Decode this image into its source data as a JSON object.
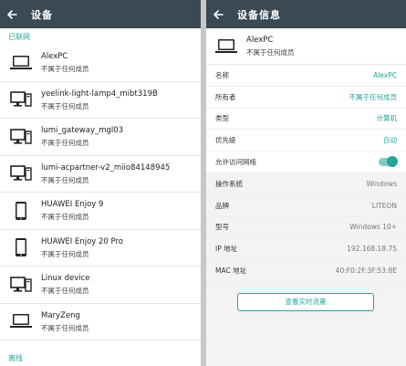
{
  "left": {
    "title": "设备",
    "online_label": "已联网",
    "offline_label": "离线",
    "devices": [
      {
        "name": "AlexPC",
        "owner": "不属于任何成员",
        "icon": "laptop-icon"
      },
      {
        "name": "yeelink-light-lamp4_mibt319B",
        "owner": "不属于任何成员",
        "icon": "desktop-icon"
      },
      {
        "name": "lumi_gateway_mgl03",
        "owner": "不属于任何成员",
        "icon": "desktop-icon"
      },
      {
        "name": "lumi-acpartner-v2_miio84148945",
        "owner": "不属于任何成员",
        "icon": "desktop-icon"
      },
      {
        "name": "HUAWEI Enjoy 9",
        "owner": "不属于任何成员",
        "icon": "phone-icon"
      },
      {
        "name": "HUAWEI Enjoy 20 Pro",
        "owner": "不属于任何成员",
        "icon": "phone-icon"
      },
      {
        "name": "Linux device",
        "owner": "不属于任何成员",
        "icon": "desktop-icon"
      },
      {
        "name": "MaryZeng",
        "owner": "不属于任何成员",
        "icon": "laptop-icon"
      }
    ]
  },
  "right": {
    "title": "设备信息",
    "device": {
      "name": "AlexPC",
      "owner": "不属于任何成员",
      "icon": "laptop-icon"
    },
    "editable_rows": [
      {
        "label": "名称",
        "value": "AlexPC"
      },
      {
        "label": "所有者",
        "value": "不属于任何成员"
      },
      {
        "label": "类型",
        "value": "计算机"
      },
      {
        "label": "优先级",
        "value": "自动"
      }
    ],
    "network_access": {
      "label": "允许访问网络",
      "enabled": true
    },
    "info_rows": [
      {
        "label": "操作系统",
        "value": "Windows"
      },
      {
        "label": "品牌",
        "value": "LITEON"
      },
      {
        "label": "型号",
        "value": "Windows 10+"
      },
      {
        "label": "IP 地址",
        "value": "192.168.18.75"
      },
      {
        "label": "MAC 地址",
        "value": "40:F0:2F:3F:53:8E"
      }
    ],
    "traffic_button": "查看实时流量"
  },
  "colors": {
    "appbar": "#3a4954",
    "accent": "#26a69a"
  }
}
